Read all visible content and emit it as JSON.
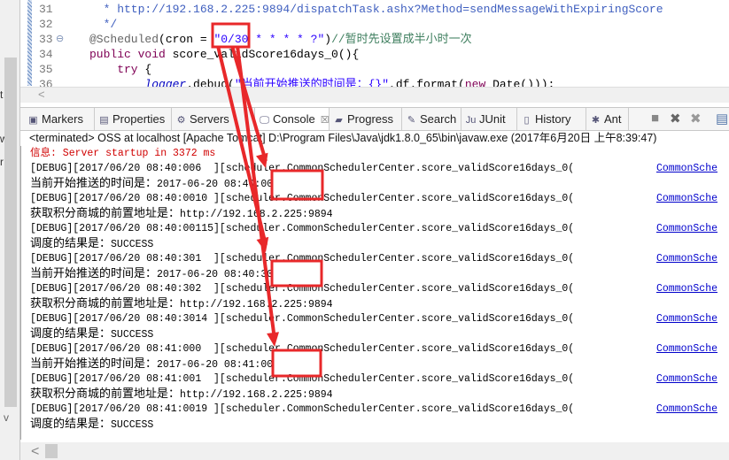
{
  "left_panel": {
    "fragments": [
      "t",
      "w",
      "r"
    ],
    "scroll_down": "v"
  },
  "editor": {
    "lines": [
      {
        "num": "31",
        "parts": [
          {
            "c": "cm",
            "t": "  * http://192.168.2.225:9894/dispatchTask.ashx?Method=sendMessageWithExpiringScore"
          }
        ]
      },
      {
        "num": "32",
        "parts": [
          {
            "c": "cm",
            "t": "  */"
          }
        ]
      },
      {
        "num": "33",
        "parts": [
          {
            "c": "ann",
            "t": "@Scheduled"
          },
          {
            "c": "",
            "t": "(cron = "
          },
          {
            "c": "str",
            "t": "\"0/30 * * * * ?\""
          },
          {
            "c": "",
            "t": ")"
          },
          {
            "c": "cmt",
            "t": "//暂时先设置成半小时一次"
          }
        ]
      },
      {
        "num": "34",
        "parts": [
          {
            "c": "kw",
            "t": "public void "
          },
          {
            "c": "",
            "t": "score_validScore16days_0(){"
          }
        ]
      },
      {
        "num": "35",
        "parts": [
          {
            "c": "kw",
            "t": "    try "
          },
          {
            "c": "",
            "t": "{"
          }
        ]
      },
      {
        "num": "36",
        "parts": [
          {
            "c": "it",
            "t": "        logger"
          },
          {
            "c": "",
            "t": ".debug("
          },
          {
            "c": "str",
            "t": "\"当前开始推送的时间是：{}\""
          },
          {
            "c": "",
            "t": ",df.format("
          },
          {
            "c": "kw",
            "t": "new "
          },
          {
            "c": "",
            "t": "Date()));"
          }
        ]
      }
    ],
    "scroll_left": "<"
  },
  "tabs": [
    {
      "label": "Markers",
      "icon": "markers-icon",
      "glyph": "▣"
    },
    {
      "label": "Properties",
      "icon": "properties-icon",
      "glyph": "▤"
    },
    {
      "label": "Servers",
      "icon": "servers-icon",
      "glyph": "⚙"
    },
    {
      "label": "Console",
      "icon": "console-icon",
      "glyph": "🖵",
      "active": true,
      "close": "☒"
    },
    {
      "label": "Progress",
      "icon": "progress-icon",
      "glyph": "▰"
    },
    {
      "label": "Search",
      "icon": "search-icon",
      "glyph": "✎"
    },
    {
      "label": "JUnit",
      "icon": "junit-icon",
      "glyph": "Ju"
    },
    {
      "label": "History",
      "icon": "history-icon",
      "glyph": "▯"
    },
    {
      "label": "Ant",
      "icon": "ant-icon",
      "glyph": "✱"
    }
  ],
  "toolbar": {
    "stop": "■",
    "remove": "✖",
    "remove_all": "✖",
    "pin": "▤"
  },
  "console": {
    "header": "<terminated> OSS at localhost [Apache Tomcat] D:\\Program Files\\Java\\jdk1.8.0_65\\bin\\javaw.exe (2017年6月20日 上午8:39:47)",
    "lines": [
      {
        "type": "err",
        "text": "信息: Server startup in 3372 ms"
      },
      {
        "type": "debug",
        "text": "[DEBUG][2017/06/20 08:40:006  ][scheduler.CommonSchedulerCenter.score_validScore16days_0(",
        "link": "CommonSche"
      },
      {
        "type": "msg",
        "label": "当前开始推送的时间是：",
        "value": "2017-06-20 08:40:00"
      },
      {
        "type": "debug",
        "text": "[DEBUG][2017/06/20 08:40:0010 ][scheduler.CommonSchedulerCenter.score_validScore16days_0(",
        "link": "CommonSche"
      },
      {
        "type": "msg",
        "label": "获取积分商城的前置地址是：",
        "value": "http://192.168.2.225:9894"
      },
      {
        "type": "debug",
        "text": "[DEBUG][2017/06/20 08:40:00115][scheduler.CommonSchedulerCenter.score_validScore16days_0(",
        "link": "CommonSche"
      },
      {
        "type": "msg",
        "label": "调度的结果是：",
        "value": "SUCCESS"
      },
      {
        "type": "debug",
        "text": "[DEBUG][2017/06/20 08:40:301  ][scheduler.CommonSchedulerCenter.score_validScore16days_0(",
        "link": "CommonSche"
      },
      {
        "type": "msg",
        "label": "当前开始推送的时间是：",
        "value": "2017-06-20 08:40:30"
      },
      {
        "type": "debug",
        "text": "[DEBUG][2017/06/20 08:40:302  ][scheduler.CommonSchedulerCenter.score_validScore16days_0(",
        "link": "CommonSche"
      },
      {
        "type": "msg",
        "label": "获取积分商城的前置地址是：",
        "value": "http://192.168.2.225:9894"
      },
      {
        "type": "debug",
        "text": "[DEBUG][2017/06/20 08:40:3014 ][scheduler.CommonSchedulerCenter.score_validScore16days_0(",
        "link": "CommonSche"
      },
      {
        "type": "msg",
        "label": "调度的结果是：",
        "value": "SUCCESS"
      },
      {
        "type": "debug",
        "text": "[DEBUG][2017/06/20 08:41:000  ][scheduler.CommonSchedulerCenter.score_validScore16days_0(",
        "link": "CommonSche"
      },
      {
        "type": "msg",
        "label": "当前开始推送的时间是：",
        "value": "2017-06-20 08:41:00"
      },
      {
        "type": "debug",
        "text": "[DEBUG][2017/06/20 08:41:001  ][scheduler.CommonSchedulerCenter.score_validScore16days_0(",
        "link": "CommonSche"
      },
      {
        "type": "msg",
        "label": "获取积分商城的前置地址是：",
        "value": "http://192.168.2.225:9894"
      },
      {
        "type": "debug",
        "text": "[DEBUG][2017/06/20 08:41:0019 ][scheduler.CommonSchedulerCenter.score_validScore16days_0(",
        "link": "CommonSche"
      },
      {
        "type": "msg",
        "label": "调度的结果是：",
        "value": "SUCCESS"
      }
    ],
    "scroll_left": "<"
  },
  "annotation_color": "#e8282a"
}
